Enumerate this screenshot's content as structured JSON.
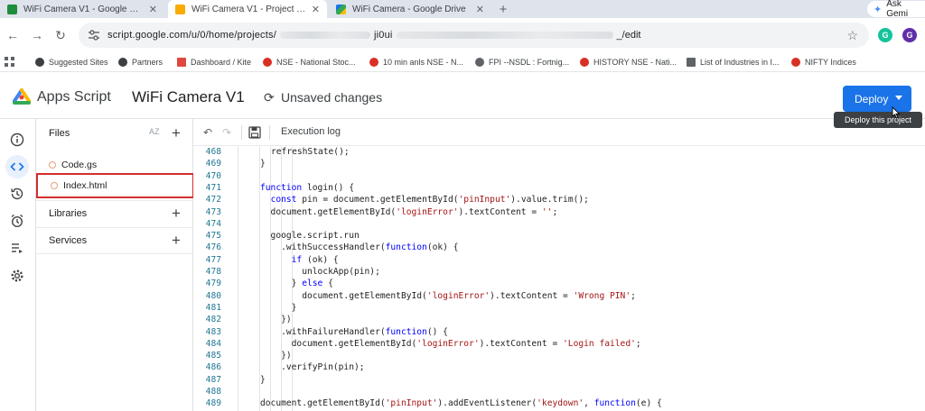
{
  "browser": {
    "tabs": [
      {
        "title": "WiFi Camera V1 - Google Sheets",
        "color": "#1e8e3e",
        "active": false
      },
      {
        "title": "WiFi Camera V1 - Project Editor",
        "color": "#f9ab00",
        "active": true
      },
      {
        "title": "WiFi Camera - Google Drive",
        "color": "#34a853",
        "active": false
      }
    ],
    "new_tab": "+",
    "gemini_label": "Ask Gemi",
    "url_start": "script.google.com/u/0/home/projects/",
    "url_mid": "ji0ui",
    "url_end": "_/edit",
    "bookmarks": [
      {
        "label": "Suggested Sites",
        "color": "#3c4043"
      },
      {
        "label": "Partners",
        "color": "#3c4043"
      },
      {
        "label": "Dashboard / Kite",
        "color": "#e0473e"
      },
      {
        "label": "NSE - National Stoc...",
        "color": "#d93025"
      },
      {
        "label": "10 min anls NSE - N...",
        "color": "#d93025"
      },
      {
        "label": "FPI --NSDL : Fortnig...",
        "color": "#5f6368"
      },
      {
        "label": "HISTORY NSE - Nati...",
        "color": "#d93025"
      },
      {
        "label": "List of Industries in I...",
        "color": "#5f6368"
      },
      {
        "label": "NIFTY Indices",
        "color": "#d93025"
      }
    ]
  },
  "app": {
    "brand": "Apps Script",
    "project_name": "WiFi Camera V1",
    "save_status": "Unsaved changes",
    "deploy_label": "Deploy",
    "deploy_tooltip": "Deploy this project",
    "accent_color": "#1a73e8"
  },
  "files_panel": {
    "title": "Files",
    "sort_label": "AZ",
    "files": [
      {
        "name": "Code.gs",
        "selected": false
      },
      {
        "name": "Index.html",
        "selected": true
      }
    ],
    "sections": [
      {
        "label": "Libraries"
      },
      {
        "label": "Services"
      }
    ]
  },
  "editor": {
    "execution_log_label": "Execution log",
    "lines": [
      {
        "n": "468",
        "code": "refreshState();"
      },
      {
        "n": "469",
        "code": "}"
      },
      {
        "n": "470",
        "code": ""
      },
      {
        "n": "471",
        "code": "function login() {"
      },
      {
        "n": "472",
        "code": "  const pin = document.getElementById('pinInput').value.trim();"
      },
      {
        "n": "473",
        "code": "  document.getElementById('loginError').textContent = '';"
      },
      {
        "n": "474",
        "code": ""
      },
      {
        "n": "475",
        "code": "  google.script.run"
      },
      {
        "n": "476",
        "code": "    .withSuccessHandler(function(ok) {"
      },
      {
        "n": "477",
        "code": "      if (ok) {"
      },
      {
        "n": "478",
        "code": "        unlockApp(pin);"
      },
      {
        "n": "479",
        "code": "      } else {"
      },
      {
        "n": "480",
        "code": "        document.getElementById('loginError').textContent = 'Wrong PIN';"
      },
      {
        "n": "481",
        "code": "      }"
      },
      {
        "n": "482",
        "code": "    })"
      },
      {
        "n": "483",
        "code": "    .withFailureHandler(function() {"
      },
      {
        "n": "484",
        "code": "      document.getElementById('loginError').textContent = 'Login failed';"
      },
      {
        "n": "485",
        "code": "    })"
      },
      {
        "n": "486",
        "code": "    .verifyPin(pin);"
      },
      {
        "n": "487",
        "code": "}"
      },
      {
        "n": "488",
        "code": ""
      },
      {
        "n": "489",
        "code": "document.getElementById('pinInput').addEventListener('keydown', function(e) {"
      }
    ]
  }
}
